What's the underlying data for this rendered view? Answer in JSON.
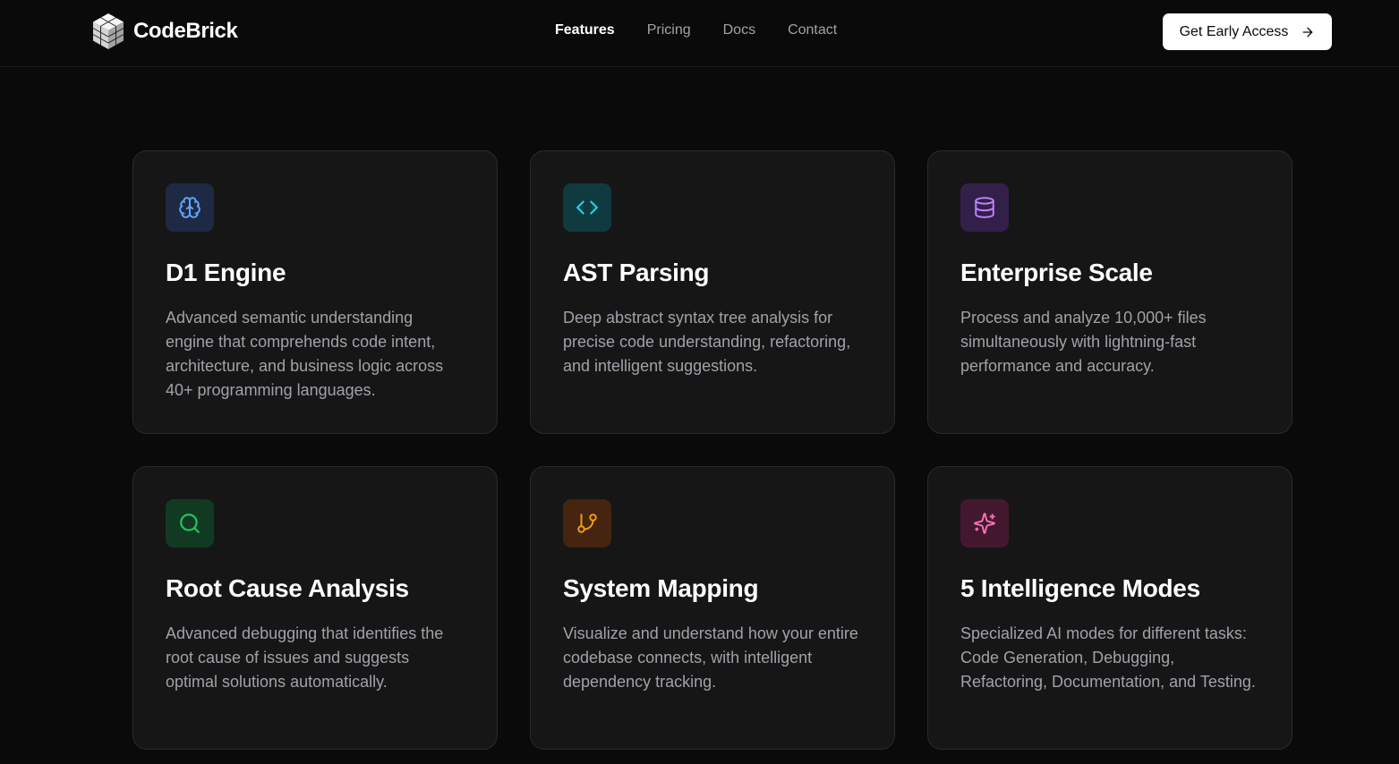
{
  "nav": {
    "brand": "CodeBrick",
    "links": [
      {
        "label": "Features",
        "active": true
      },
      {
        "label": "Pricing",
        "active": false
      },
      {
        "label": "Docs",
        "active": false
      },
      {
        "label": "Contact",
        "active": false
      }
    ],
    "cta_label": "Get Early Access",
    "cta_icon": "arrow-right-icon"
  },
  "features": [
    {
      "title": "D1 Engine",
      "description": "Advanced semantic understanding engine that comprehends code intent, architecture, and business logic across 40+ programming languages.",
      "icon": "brain-icon",
      "icon_color": "#60a5fa",
      "icon_bg": "#1e2a44"
    },
    {
      "title": "AST Parsing",
      "description": "Deep abstract syntax tree analysis for precise code understanding, refactoring, and intelligent suggestions.",
      "icon": "code-icon",
      "icon_color": "#22d3ee",
      "icon_bg": "#0f3a40"
    },
    {
      "title": "Enterprise Scale",
      "description": "Process and analyze 10,000+ files simultaneously with lightning-fast performance and accuracy.",
      "icon": "database-icon",
      "icon_color": "#c084fc",
      "icon_bg": "#33204a"
    },
    {
      "title": "Root Cause Analysis",
      "description": "Advanced debugging that identifies the root cause of issues and suggests optimal solutions automatically.",
      "icon": "search-icon",
      "icon_color": "#22c55e",
      "icon_bg": "#123a22"
    },
    {
      "title": "System Mapping",
      "description": "Visualize and understand how your entire codebase connects, with intelligent dependency tracking.",
      "icon": "git-branch-icon",
      "icon_color": "#f59e0b",
      "icon_bg": "#452410"
    },
    {
      "title": "5 Intelligence Modes",
      "description": "Specialized AI modes for different tasks: Code Generation, Debugging, Refactoring, Documentation, and Testing.",
      "icon": "sparkles-icon",
      "icon_color": "#f472b6",
      "icon_bg": "#43182f"
    }
  ]
}
